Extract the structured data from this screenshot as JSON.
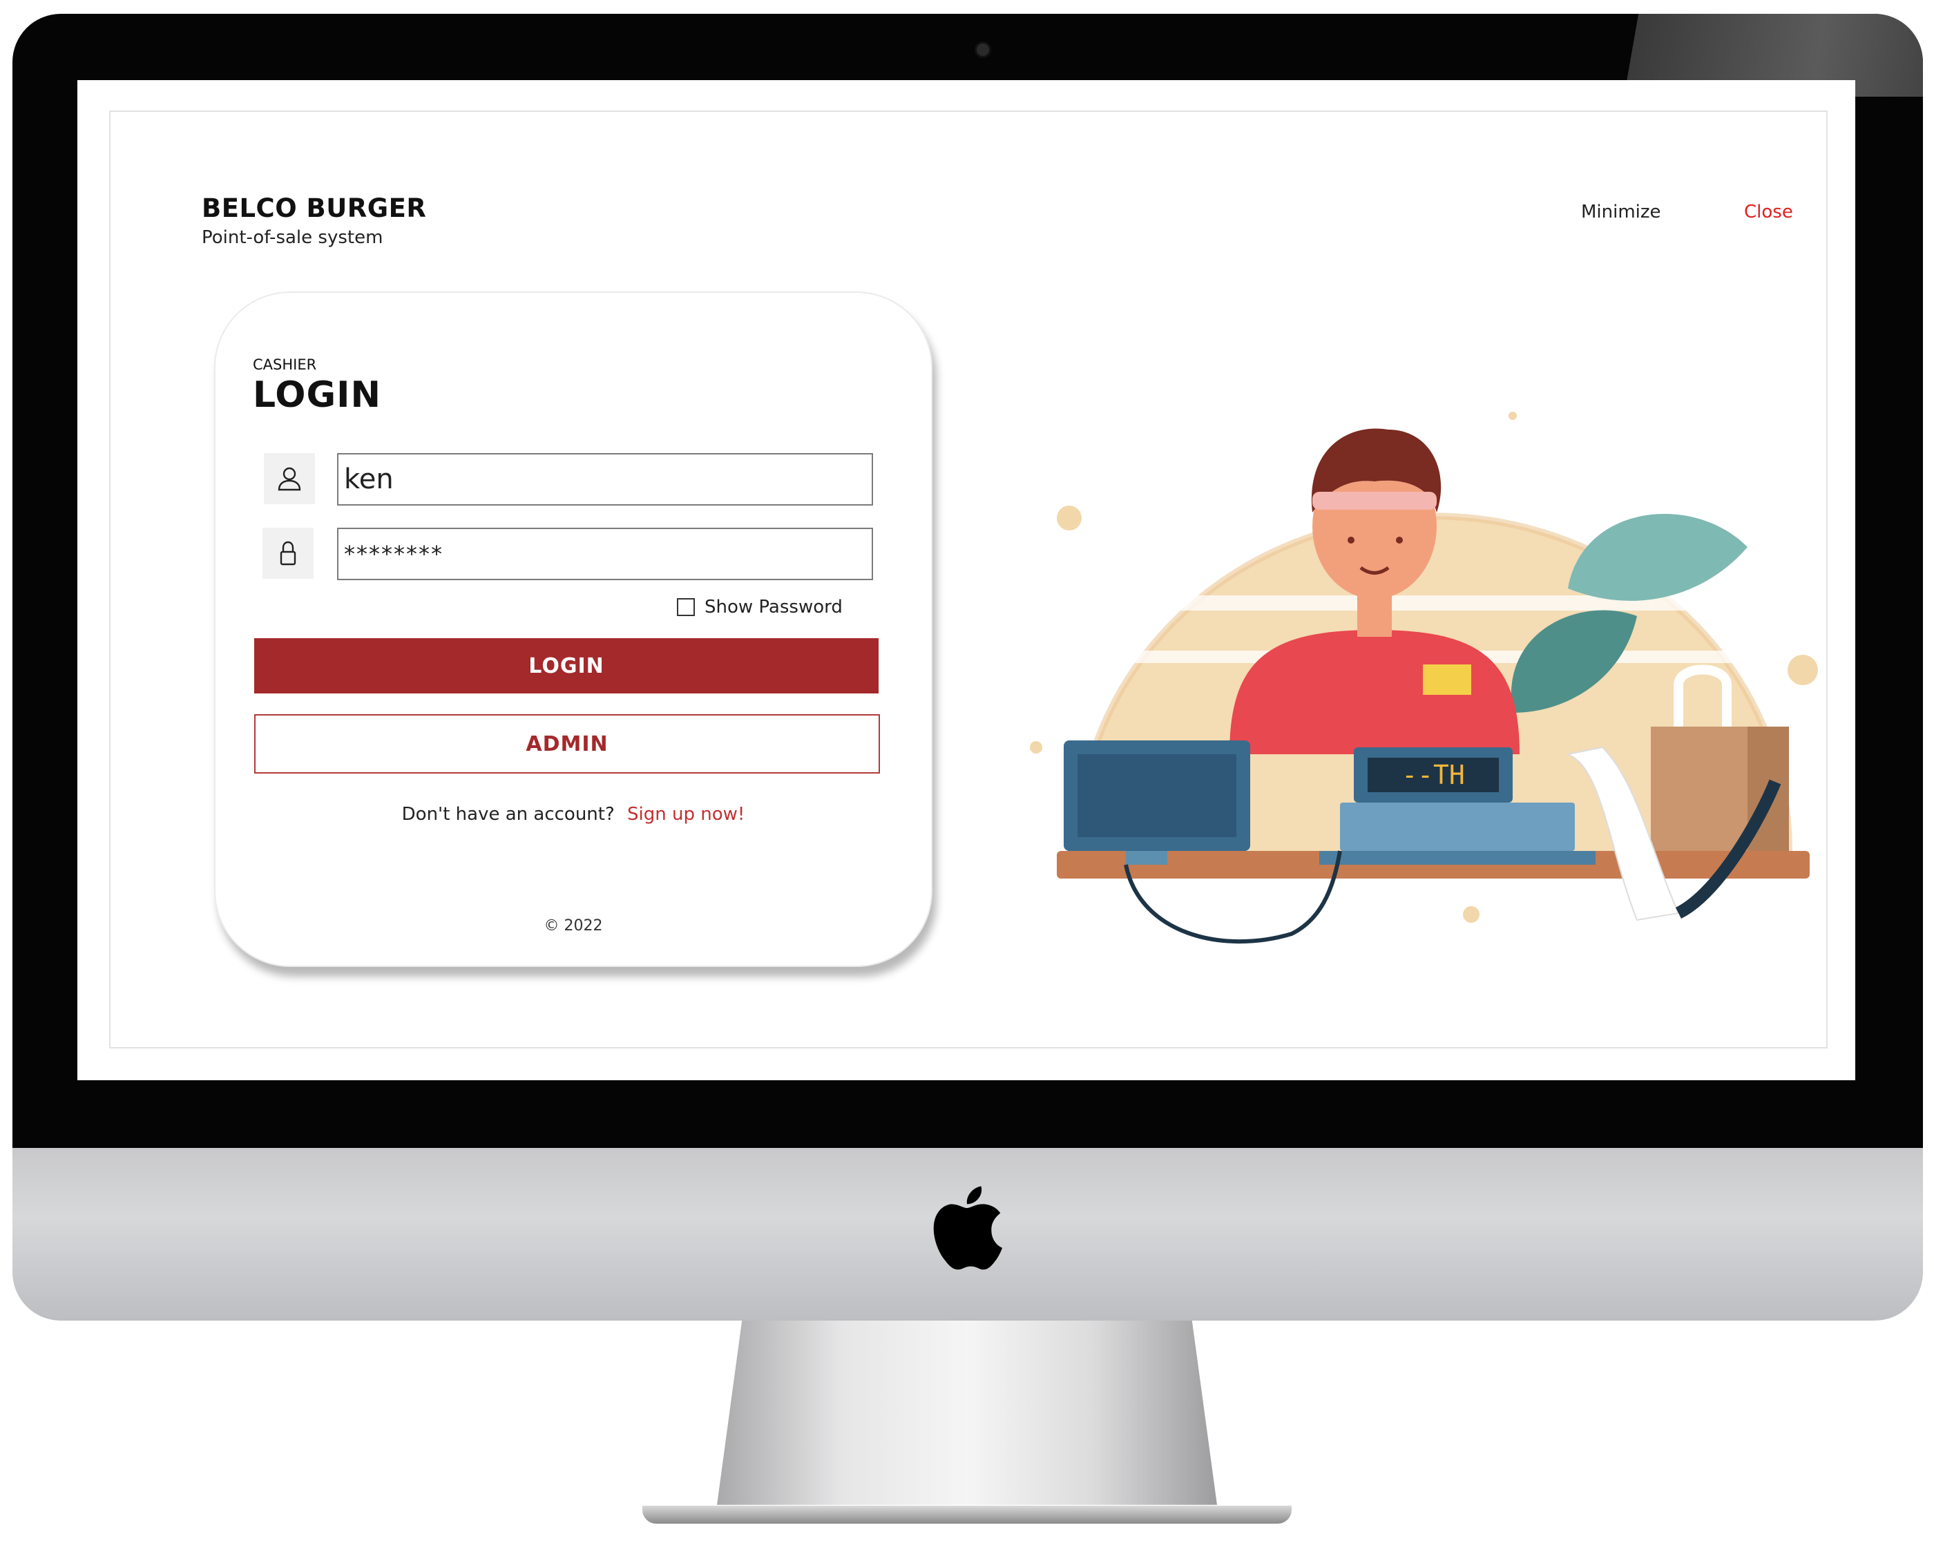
{
  "app": {
    "brand_name": "BELCO BURGER",
    "brand_subtitle": "Point-of-sale system"
  },
  "window_controls": {
    "minimize": "Minimize",
    "close": "Close"
  },
  "login_card": {
    "subtitle": "CASHIER",
    "title": "LOGIN",
    "username_value": "ken",
    "password_value": "********",
    "show_password_label": "Show Password",
    "show_password_checked": false,
    "login_button": "LOGIN",
    "admin_button": "ADMIN",
    "signup_prompt": "Don't have an account?",
    "signup_link": "Sign up now!",
    "copyright": "© 2022"
  },
  "illustration": {
    "register_display": "--TH"
  },
  "colors": {
    "primary": "#a3292b",
    "close": "#e0201f",
    "link": "#c2302f"
  }
}
